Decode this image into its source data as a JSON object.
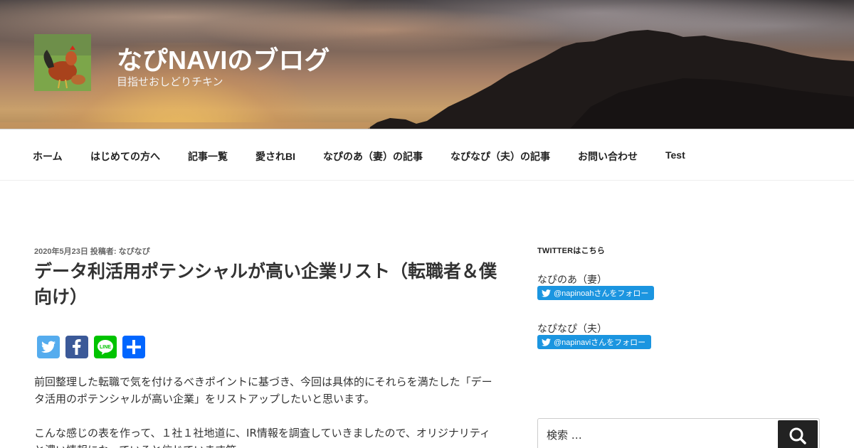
{
  "site": {
    "title": "なぴNAVIのブログ",
    "description": "目指せおしどりチキン"
  },
  "nav": {
    "items": [
      {
        "label": "ホーム"
      },
      {
        "label": "はじめての方へ"
      },
      {
        "label": "記事一覧"
      },
      {
        "label": "愛されBI"
      },
      {
        "label": "なぴのあ（妻）の記事"
      },
      {
        "label": "なぴなぴ（夫）の記事"
      },
      {
        "label": "お問い合わせ"
      },
      {
        "label": "Test"
      }
    ]
  },
  "post": {
    "date": "2020年5月23日",
    "author_prefix": "投稿者:",
    "author": "なぴなぴ",
    "title": "データ利活用ポテンシャルが高い企業リスト（転職者＆僕向け）",
    "share_icons": [
      "twitter-icon",
      "facebook-icon",
      "line-icon",
      "share-icon"
    ],
    "paragraphs": [
      "前回整理した転職で気を付けるべきポイントに基づき、今回は具体的にそれらを満たした「データ活用のポテンシャルが高い企業」をリストアップしたいと思います。",
      "こんな感じの表を作って、１社１社地道に、IR情報を調査していきましたので、オリジナリティと濃い情報になっていると信じています笑"
    ]
  },
  "sidebar": {
    "twitter_title": "TWITTERはこちら",
    "accounts": [
      {
        "label": "なぴのあ（妻）",
        "button": "@napinoahさんをフォロー"
      },
      {
        "label": "なぴなぴ（夫）",
        "button": "@napinaviさんをフォロー"
      }
    ],
    "search": {
      "placeholder": "検索 …",
      "button_icon": "search-icon"
    }
  },
  "colors": {
    "twitter": "#55acee",
    "facebook": "#3b5998",
    "line": "#00c300",
    "share": "#0166ff",
    "follow_button": "#1b95e0"
  }
}
